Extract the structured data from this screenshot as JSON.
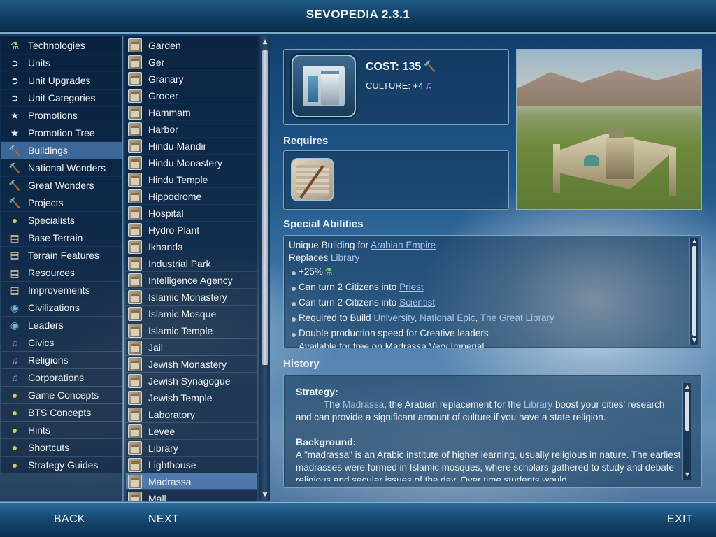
{
  "header": {
    "title": "SEVOPEDIA 2.3.1"
  },
  "footer": {
    "back": "BACK",
    "next": "NEXT",
    "exit": "EXIT"
  },
  "categories": [
    {
      "label": "Technologies",
      "icon": "flask-icon"
    },
    {
      "label": "Units",
      "icon": "unit-icon"
    },
    {
      "label": "Unit Upgrades",
      "icon": "unit-icon"
    },
    {
      "label": "Unit Categories",
      "icon": "unit-icon"
    },
    {
      "label": "Promotions",
      "icon": "star-icon"
    },
    {
      "label": "Promotion Tree",
      "icon": "star-icon"
    },
    {
      "label": "Buildings",
      "icon": "hammer-icon"
    },
    {
      "label": "National Wonders",
      "icon": "hammer-icon"
    },
    {
      "label": "Great Wonders",
      "icon": "hammer-icon"
    },
    {
      "label": "Projects",
      "icon": "hammer-icon"
    },
    {
      "label": "Specialists",
      "icon": "specialist-icon"
    },
    {
      "label": "Base Terrain",
      "icon": "scroll-icon"
    },
    {
      "label": "Terrain Features",
      "icon": "scroll-icon"
    },
    {
      "label": "Resources",
      "icon": "scroll-icon"
    },
    {
      "label": "Improvements",
      "icon": "scroll-icon"
    },
    {
      "label": "Civilizations",
      "icon": "globe-icon"
    },
    {
      "label": "Leaders",
      "icon": "globe-icon"
    },
    {
      "label": "Civics",
      "icon": "music-note-icon"
    },
    {
      "label": "Religions",
      "icon": "music-note-icon"
    },
    {
      "label": "Corporations",
      "icon": "music-note-icon"
    },
    {
      "label": "Game Concepts",
      "icon": "coin-icon"
    },
    {
      "label": "BTS Concepts",
      "icon": "coin-icon"
    },
    {
      "label": "Hints",
      "icon": "coin-icon"
    },
    {
      "label": "Shortcuts",
      "icon": "coin-icon"
    },
    {
      "label": "Strategy Guides",
      "icon": "coin-icon"
    }
  ],
  "selected_category": "Buildings",
  "buildings": [
    "Garden",
    "Ger",
    "Granary",
    "Grocer",
    "Hammam",
    "Harbor",
    "Hindu Mandir",
    "Hindu Monastery",
    "Hindu Temple",
    "Hippodrome",
    "Hospital",
    "Hydro Plant",
    "Ikhanda",
    "Industrial Park",
    "Intelligence Agency",
    "Islamic Monastery",
    "Islamic Mosque",
    "Islamic Temple",
    "Jail",
    "Jewish Monastery",
    "Jewish Synagogue",
    "Jewish Temple",
    "Laboratory",
    "Levee",
    "Library",
    "Lighthouse",
    "Madrassa",
    "Mall"
  ],
  "selected_building": "Madrassa",
  "detail": {
    "cost": "COST: 135",
    "culture": "CULTURE: +4",
    "requires_title": "Requires",
    "abilities_title": "Special Abilities",
    "unique_for_prefix": "Unique Building for ",
    "unique_for_link": "Arabian Empire",
    "replaces_prefix": "Replaces ",
    "replaces_link": "Library",
    "bullets": [
      {
        "text": "+25%"
      },
      {
        "text": "Can turn 2 Citizens into ",
        "link": "Priest"
      },
      {
        "text": "Can turn 2 Citizens into ",
        "link": "Scientist"
      },
      {
        "text": "Required to Build ",
        "links": [
          "University",
          "National Epic",
          "The Great Library"
        ]
      },
      {
        "text": "Double production speed for Creative leaders"
      },
      {
        "text": "Available for free on Madrassa Very Imperial"
      }
    ],
    "history_title": "History",
    "strategy_heading": "Strategy:",
    "strategy": {
      "pre": "The ",
      "hl1": "Madrassa",
      "mid": ", the Arabian replacement for the ",
      "hl2": "Library",
      "post": " boost your cities' research and can provide a significant amount of culture if you have a state religion."
    },
    "background_heading": "Background:",
    "background": "A \"madrassa\" is an Arabic institute of higher learning, usually religious in nature. The earliest madrasses were formed in Islamic mosques, where scholars gathered to study and debate religious and secular issues of the day. Over time students would"
  }
}
